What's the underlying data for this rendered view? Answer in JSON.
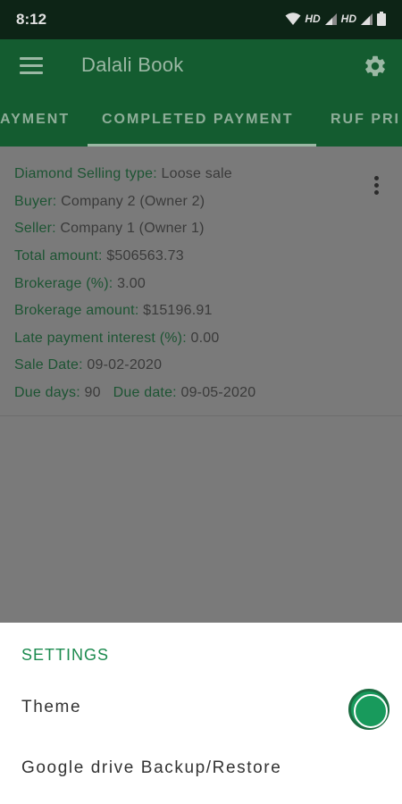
{
  "status_bar": {
    "time": "8:12",
    "hd_1": "HD",
    "hd_2": "HD"
  },
  "app_bar": {
    "title": "Dalali Book",
    "menu_icon": "hamburger-menu-icon",
    "settings_icon": "gear-icon"
  },
  "tabs": [
    {
      "label": "AYMENT"
    },
    {
      "label": "COMPLETED PAYMENT",
      "selected": true
    },
    {
      "label": "RUF PRI"
    }
  ],
  "card": {
    "selling_type_label": "Diamond Selling type:",
    "selling_type": "Loose sale",
    "buyer_label": "Buyer:",
    "buyer": "Company 2 (Owner 2)",
    "seller_label": "Seller:",
    "seller": "Company 1 (Owner 1)",
    "total_amount_label": "Total amount:",
    "total_amount": "$506563.73",
    "brokerage_pct_label": "Brokerage (%):",
    "brokerage_pct": "3.00",
    "brokerage_amount_label": "Brokerage amount:",
    "brokerage_amount": "$15196.91",
    "late_interest_label": "Late payment interest (%):",
    "late_interest": "0.00",
    "sale_date_label": "Sale Date:",
    "sale_date": "09-02-2020",
    "due_days_label": "Due days:",
    "due_days": "90",
    "due_date_label": "Due date:",
    "due_date": "09-05-2020"
  },
  "sheet": {
    "heading": "SETTINGS",
    "theme_label": "Theme",
    "theme_color": "#189a5c",
    "backup_label": "Google drive Backup/Restore"
  },
  "colors": {
    "status_bar": "#0d2416",
    "app_bar": "#145c30",
    "accent": "#1b8a4e",
    "scrim": "#7a7a7a"
  }
}
